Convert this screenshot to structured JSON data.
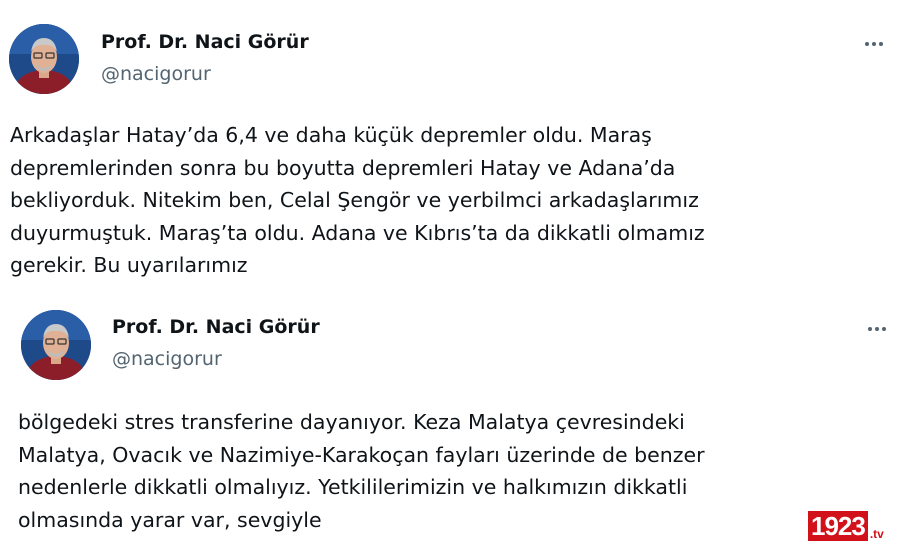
{
  "tweets": [
    {
      "author_name": "Prof. Dr. Naci Görür",
      "author_handle": "@nacigorur",
      "more_icon": "more-horizontal-icon",
      "text": "Arkadaşlar Hatay’da 6,4 ve daha küçük depremler oldu. Maraş\ndepremlerinden sonra bu boyutta depremleri Hatay ve Adana’da\nbekliyorduk. Nitekim ben, Celal Şengör ve yerbilmci arkadaşlarımız\nduyurmuştuk. Maraş’ta oldu. Adana ve Kıbrıs’ta da dikkatli olmamız\ngerekir. Bu uyarılarımız"
    },
    {
      "author_name": "Prof. Dr. Naci Görür",
      "author_handle": "@nacigorur",
      "more_icon": "more-horizontal-icon",
      "text": "bölgedeki stres transferine dayanıyor. Keza Malatya çevresindeki\nMalatya, Ovacık ve Nazimiye-Karakoçan fayları üzerinde de benzer\nnedenlerle dikkatli olmalıyız. Yetkililerimizin ve halkımızın dikkatli\nolmasında yarar var, sevgiyle"
    }
  ],
  "watermark": {
    "number": "1923",
    "suffix": ".tv",
    "color": "#d2121a"
  },
  "colors": {
    "text": "#0f1419",
    "secondary": "#536471",
    "background": "#ffffff"
  }
}
